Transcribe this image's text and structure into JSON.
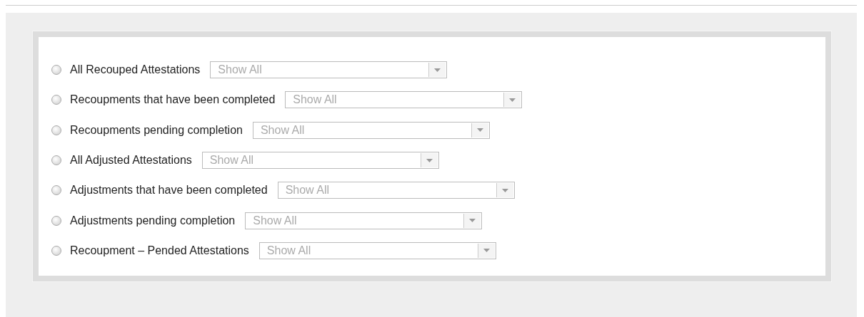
{
  "options": [
    {
      "label": "All Recouped Attestations",
      "selected": false,
      "filter": "Show All"
    },
    {
      "label": "Recoupments that have been completed",
      "selected": false,
      "filter": "Show All"
    },
    {
      "label": "Recoupments pending completion",
      "selected": false,
      "filter": "Show All"
    },
    {
      "label": "All Adjusted Attestations",
      "selected": false,
      "filter": "Show All"
    },
    {
      "label": "Adjustments that have been completed",
      "selected": false,
      "filter": "Show All"
    },
    {
      "label": "Adjustments pending completion",
      "selected": false,
      "filter": "Show All"
    },
    {
      "label": "Recoupment – Pended Attestations",
      "selected": false,
      "filter": "Show All"
    }
  ]
}
